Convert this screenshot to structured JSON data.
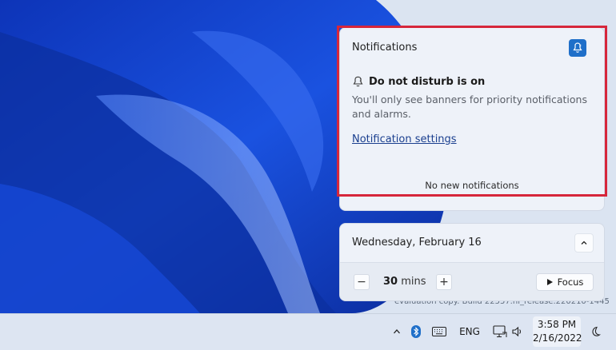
{
  "notifications": {
    "title": "Notifications",
    "dnd_heading": "Do not disturb is on",
    "dnd_body": "You'll only see banners for priority notifications and alarms.",
    "settings_link": "Notification settings",
    "empty_text": "No new notifications"
  },
  "calendar": {
    "date": "Wednesday, February 16",
    "focus_duration": "30",
    "focus_unit": "mins",
    "minus_label": "−",
    "plus_label": "+",
    "focus_button": "Focus"
  },
  "taskbar": {
    "language": "ENG",
    "time": "3:58 PM",
    "date": "2/16/2022"
  },
  "watermark": "evaluation copy. Build 22557.ni_release.220210-1445",
  "colors": {
    "accent": "#1f6fc9",
    "highlight": "#d6263b",
    "wallpaper_base": "#1c4fd6"
  },
  "icons": [
    "do-not-disturb-icon",
    "bell-snooze-icon",
    "chevron-up-icon",
    "play-icon",
    "bluetooth-icon",
    "keyboard-icon",
    "network-icon",
    "volume-icon",
    "moon-icon"
  ]
}
